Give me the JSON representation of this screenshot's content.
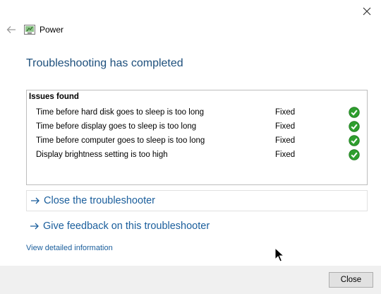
{
  "window": {
    "app_title": "Power",
    "icons": {
      "back": "back-arrow-icon",
      "close": "close-icon",
      "app": "power-troubleshooter-icon"
    }
  },
  "heading": "Troubleshooting has completed",
  "issues": {
    "title": "Issues found",
    "rows": [
      {
        "text": "Time before hard disk goes to sleep is too long",
        "status": "Fixed"
      },
      {
        "text": "Time before display goes to sleep is too long",
        "status": "Fixed"
      },
      {
        "text": "Time before computer goes to sleep is too long",
        "status": "Fixed"
      },
      {
        "text": "Display brightness setting is too high",
        "status": "Fixed"
      }
    ]
  },
  "links": {
    "close_troubleshooter": "Close the troubleshooter",
    "give_feedback": "Give feedback on this troubleshooter",
    "view_details": "View detailed information"
  },
  "footer": {
    "close_label": "Close"
  },
  "colors": {
    "heading": "#1d4f7c",
    "link": "#1a5e9c",
    "check_green": "#2e9e2e"
  }
}
